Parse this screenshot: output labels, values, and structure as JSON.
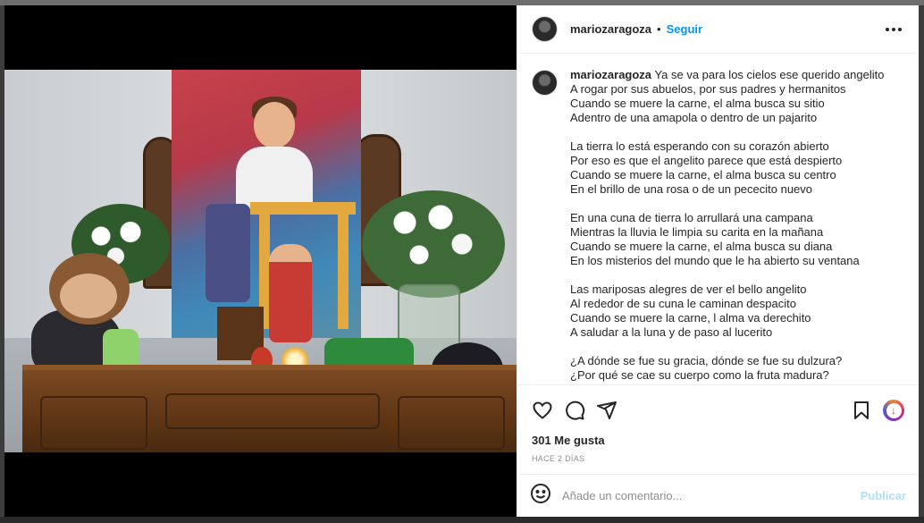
{
  "post": {
    "username": "mariozaragoza",
    "separator": "•",
    "follow_label": "Seguir",
    "caption_user": "mariozaragoza",
    "stanzas": [
      [
        "Ya se va para los cielos ese querido angelito",
        "A rogar por sus abuelos, por sus padres y hermanitos",
        "Cuando se muere la carne, el alma busca su sitio",
        "Adentro de una amapola o dentro de un pajarito"
      ],
      [
        "La tierra lo está esperando con su corazón abierto",
        "Por eso es que el angelito parece que está despierto",
        "Cuando se muere la carne, el alma busca su centro",
        "En el brillo de una rosa o de un pececito nuevo"
      ],
      [
        "En una cuna de tierra lo arrullará una campana",
        "Mientras la lluvia le limpia su carita en la mañana",
        "Cuando se muere la carne, el alma busca su diana",
        "En los misterios del mundo que le ha abierto su ventana"
      ],
      [
        "Las mariposas alegres de ver el bello angelito",
        "Al rededor de su cuna le caminan despacito",
        "Cuando se muere la carne, l alma va derechito",
        "A saludar a la luna y de paso al lucerito"
      ],
      [
        "¿A dónde se fue su gracia, dónde se fue su dulzura?",
        "¿Por qué se cae su cuerpo como la fruta madura?"
      ]
    ],
    "likes": "301 Me gusta",
    "time": "HACE 2 DÍAS"
  },
  "comment_form": {
    "placeholder": "Añade un comentario...",
    "publish_label": "Publicar"
  },
  "icons": {
    "more": "more-options-icon",
    "like": "heart-icon",
    "comment": "comment-icon",
    "share": "share-icon",
    "save": "bookmark-icon",
    "download": "download-icon",
    "emoji": "emoji-icon"
  },
  "colors": {
    "link": "#0095f6",
    "publish_disabled": "#b2dffc",
    "muted": "#8e8e8e"
  }
}
